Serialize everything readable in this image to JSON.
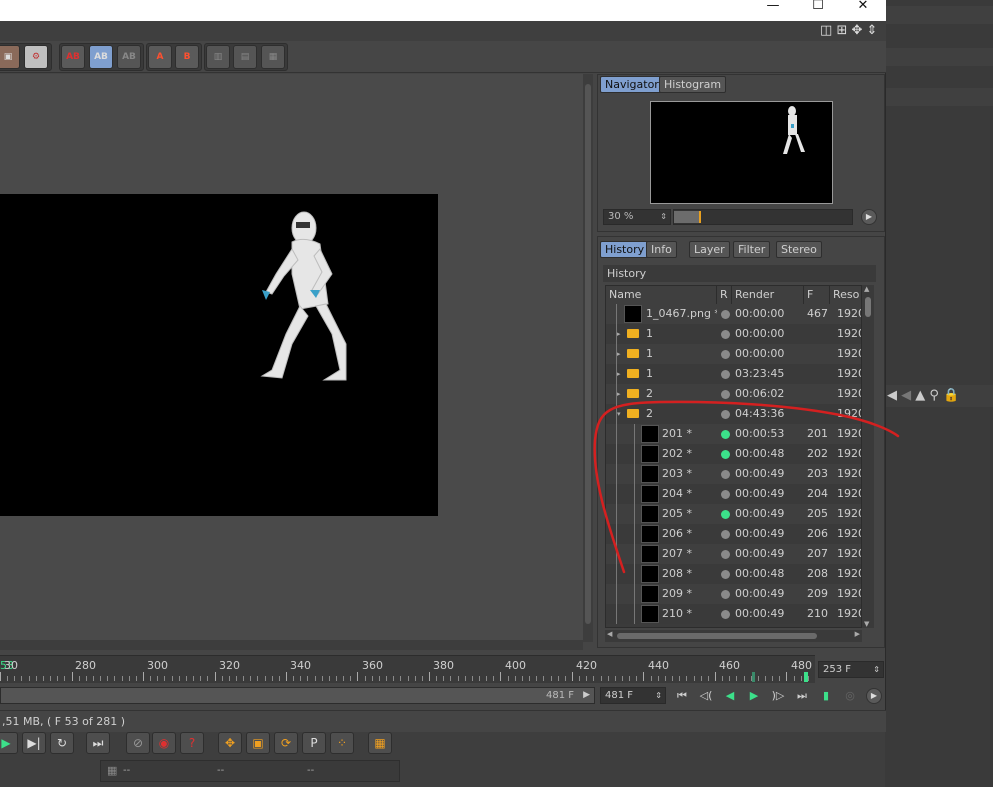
{
  "window": {
    "minimize": "—",
    "maximize": "☐",
    "close": "✕"
  },
  "navigator": {
    "tabs": [
      "Navigator",
      "Histogram"
    ],
    "zoom": "30 %",
    "zoom_slider_fraction": 0.14
  },
  "history_panel": {
    "tabs": [
      "History",
      "Info",
      "Layer",
      "Filter",
      "Stereo"
    ],
    "header": "History",
    "columns": [
      "Name",
      "R",
      "Render Time",
      "F",
      "Reso"
    ],
    "rows": [
      {
        "name": "1_0467.png *",
        "kind": "image",
        "status": "gray",
        "time": "00:00:00",
        "frame": "467",
        "res": "1920"
      },
      {
        "name": "1",
        "kind": "folder",
        "status": "gray",
        "time": "00:00:00",
        "frame": "",
        "res": "1920"
      },
      {
        "name": "1",
        "kind": "folder",
        "status": "gray",
        "time": "00:00:00",
        "frame": "",
        "res": "1920"
      },
      {
        "name": "1",
        "kind": "folder",
        "status": "gray",
        "time": "03:23:45",
        "frame": "",
        "res": "1920"
      },
      {
        "name": "2",
        "kind": "folder",
        "status": "gray",
        "time": "00:06:02",
        "frame": "",
        "res": "1920"
      },
      {
        "name": "2",
        "kind": "folder-open",
        "status": "gray",
        "time": "04:43:36",
        "frame": "",
        "res": "1920"
      },
      {
        "name": "201 *",
        "kind": "child",
        "status": "green",
        "time": "00:00:53",
        "frame": "201",
        "res": "1920"
      },
      {
        "name": "202 *",
        "kind": "child",
        "status": "green",
        "time": "00:00:48",
        "frame": "202",
        "res": "1920"
      },
      {
        "name": "203 *",
        "kind": "child",
        "status": "gray",
        "time": "00:00:49",
        "frame": "203",
        "res": "1920"
      },
      {
        "name": "204 *",
        "kind": "child",
        "status": "gray",
        "time": "00:00:49",
        "frame": "204",
        "res": "1920"
      },
      {
        "name": "205 *",
        "kind": "child",
        "status": "green",
        "time": "00:00:49",
        "frame": "205",
        "res": "1920"
      },
      {
        "name": "206 *",
        "kind": "child",
        "status": "gray",
        "time": "00:00:49",
        "frame": "206",
        "res": "1920"
      },
      {
        "name": "207 *",
        "kind": "child",
        "status": "gray",
        "time": "00:00:49",
        "frame": "207",
        "res": "1920"
      },
      {
        "name": "208 *",
        "kind": "child",
        "status": "gray",
        "time": "00:00:48",
        "frame": "208",
        "res": "1920"
      },
      {
        "name": "209 *",
        "kind": "child",
        "status": "gray",
        "time": "00:00:49",
        "frame": "209",
        "res": "1920"
      },
      {
        "name": "210 *",
        "kind": "child",
        "status": "gray",
        "time": "00:00:49",
        "frame": "210",
        "res": "1920"
      }
    ]
  },
  "timeline": {
    "first_label": "53",
    "labels": [
      "30",
      "280",
      "300",
      "320",
      "340",
      "360",
      "380",
      "400",
      "420",
      "440",
      "460",
      "480"
    ],
    "current_frame": "253 F",
    "range_end": "481 F",
    "end_frame": "481 F"
  },
  "status": {
    "text": ",51 MB,  ( F 53 of 281 )"
  },
  "bottom": {
    "dashes": [
      "--",
      "--",
      "--"
    ]
  },
  "colors": {
    "accent_tab": "#7f9fcf",
    "status_green": "#3ce08a",
    "folder": "#f0b020",
    "annotation": "#d42020"
  }
}
